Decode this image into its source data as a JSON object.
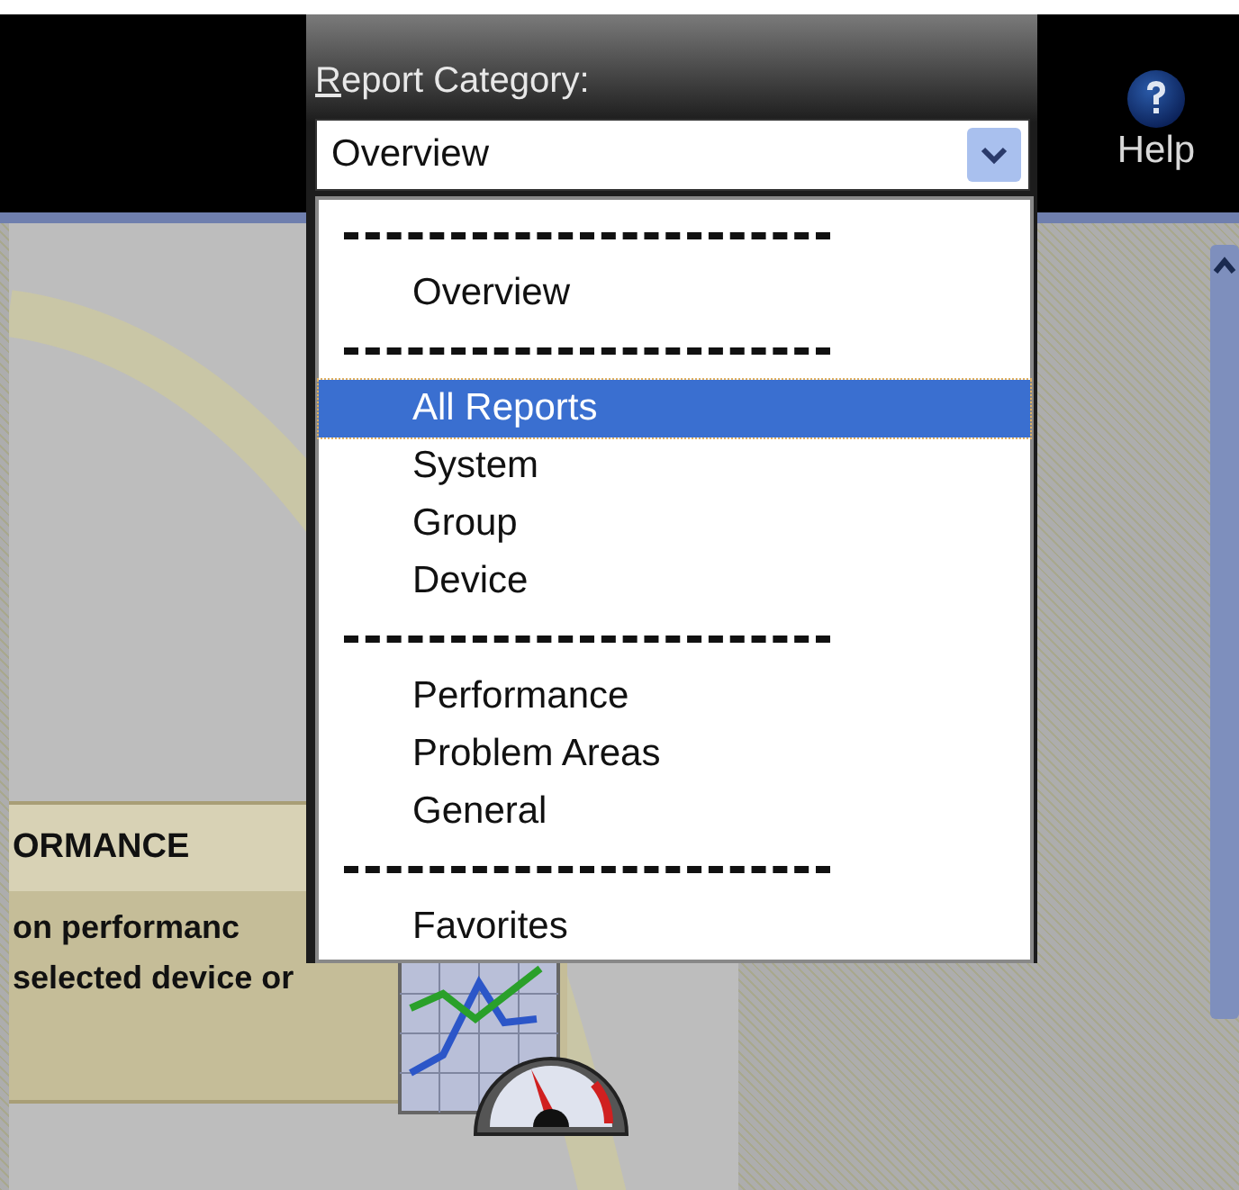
{
  "header": {
    "help_label": "Help"
  },
  "report_category": {
    "label": "Report Category:",
    "value": "Overview",
    "expanded": true
  },
  "dropdown_items": [
    {
      "kind": "separator"
    },
    {
      "kind": "option",
      "label": "Overview",
      "selected": false
    },
    {
      "kind": "separator"
    },
    {
      "kind": "option",
      "label": "All Reports",
      "selected": true
    },
    {
      "kind": "option",
      "label": "System",
      "selected": false
    },
    {
      "kind": "option",
      "label": "Group",
      "selected": false
    },
    {
      "kind": "option",
      "label": "Device",
      "selected": false
    },
    {
      "kind": "separator"
    },
    {
      "kind": "option",
      "label": "Performance",
      "selected": false
    },
    {
      "kind": "option",
      "label": "Problem Areas",
      "selected": false
    },
    {
      "kind": "option",
      "label": "General",
      "selected": false
    },
    {
      "kind": "separator"
    },
    {
      "kind": "option",
      "label": "Favorites",
      "selected": false
    }
  ],
  "card": {
    "title": "ORMANCE",
    "lines": [
      "on performanc",
      "selected device or"
    ]
  }
}
